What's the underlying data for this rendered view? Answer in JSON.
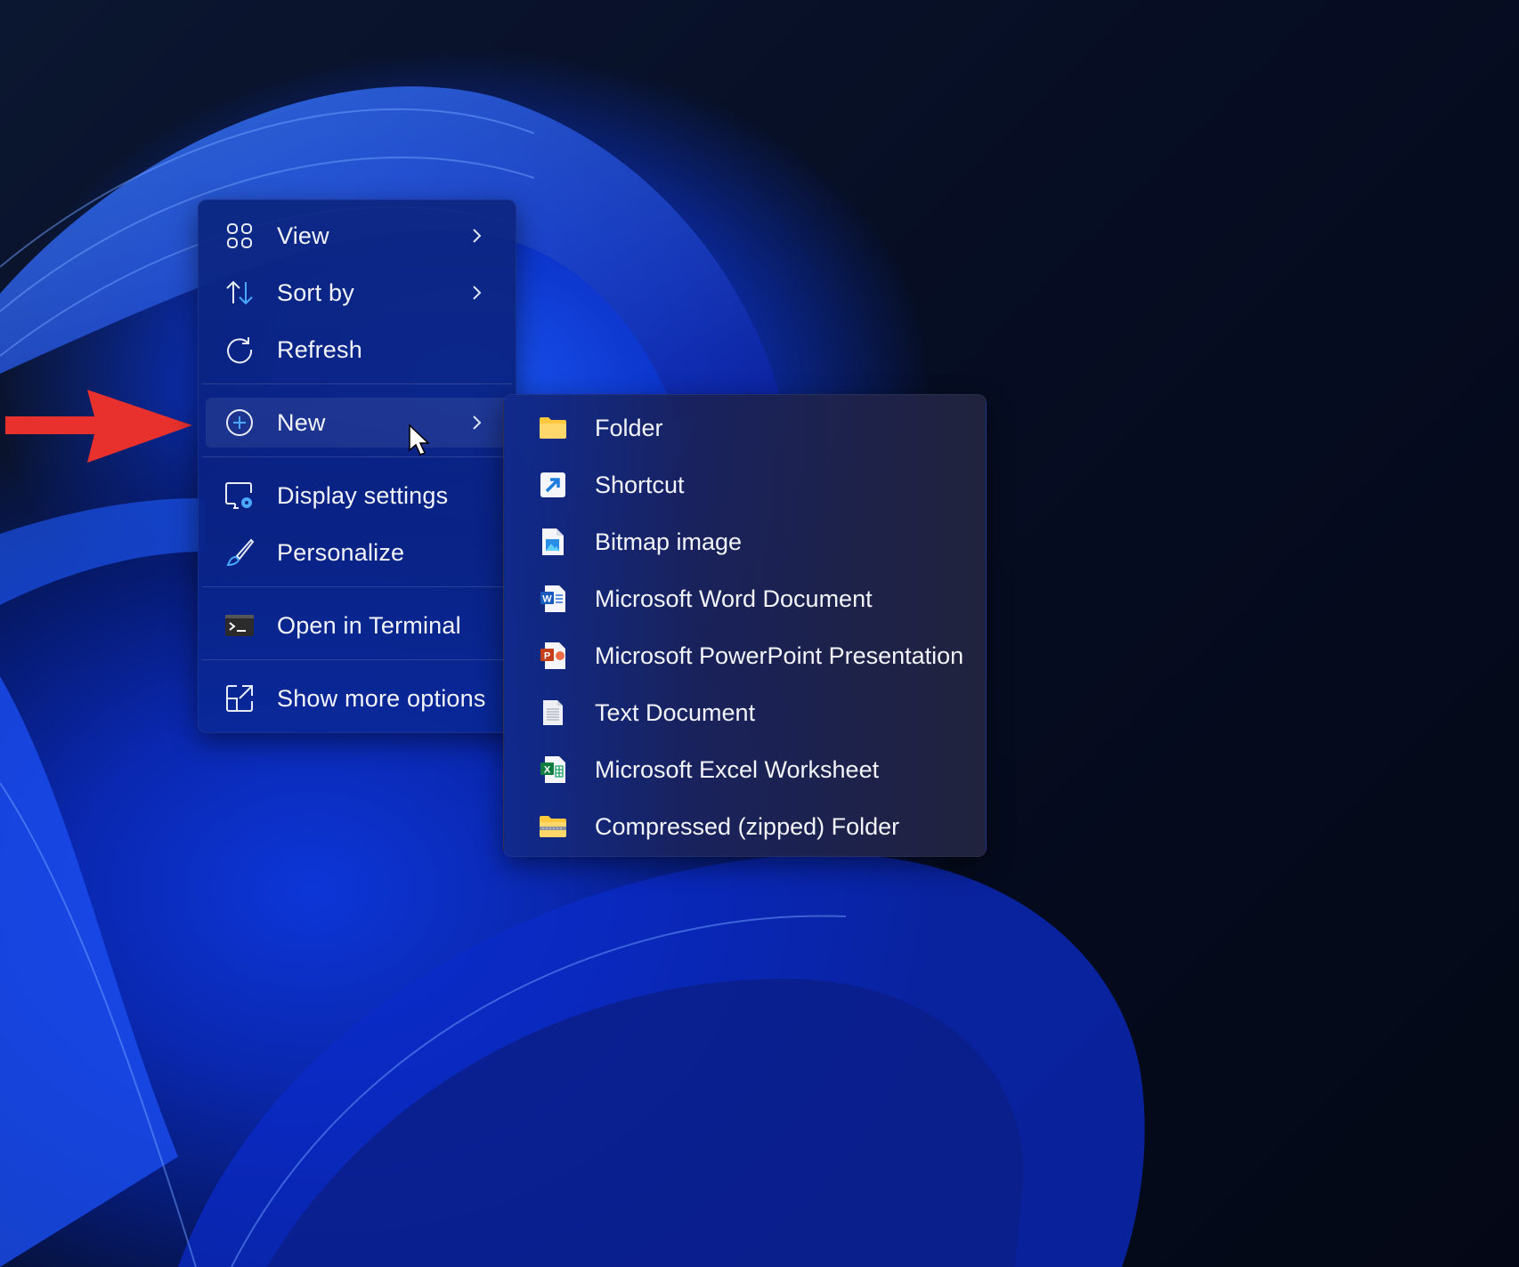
{
  "context_menu": {
    "items": [
      {
        "label": "View",
        "icon": "grid-view-icon",
        "has_submenu": true
      },
      {
        "label": "Sort by",
        "icon": "sort-arrows-icon",
        "has_submenu": true
      },
      {
        "label": "Refresh",
        "icon": "refresh-icon",
        "has_submenu": false
      },
      {
        "label": "New",
        "icon": "plus-circle-icon",
        "has_submenu": true,
        "active": true
      },
      {
        "label": "Display settings",
        "icon": "display-settings-icon",
        "has_submenu": false
      },
      {
        "label": "Personalize",
        "icon": "paintbrush-icon",
        "has_submenu": false
      },
      {
        "label": "Open in Terminal",
        "icon": "terminal-icon",
        "has_submenu": false
      },
      {
        "label": "Show more options",
        "icon": "show-more-options-icon",
        "has_submenu": false
      }
    ]
  },
  "new_submenu": {
    "items": [
      {
        "label": "Folder",
        "icon": "folder-icon"
      },
      {
        "label": "Shortcut",
        "icon": "shortcut-icon"
      },
      {
        "label": "Bitmap image",
        "icon": "bitmap-image-icon"
      },
      {
        "label": "Microsoft Word Document",
        "icon": "word-document-icon"
      },
      {
        "label": "Microsoft PowerPoint Presentation",
        "icon": "powerpoint-icon"
      },
      {
        "label": "Text Document",
        "icon": "text-document-icon"
      },
      {
        "label": "Microsoft Excel Worksheet",
        "icon": "excel-worksheet-icon"
      },
      {
        "label": "Compressed (zipped) Folder",
        "icon": "zipped-folder-icon"
      }
    ]
  },
  "colors": {
    "annotation_arrow": "#e8312c",
    "accent_blue": "#4aa8ff"
  }
}
